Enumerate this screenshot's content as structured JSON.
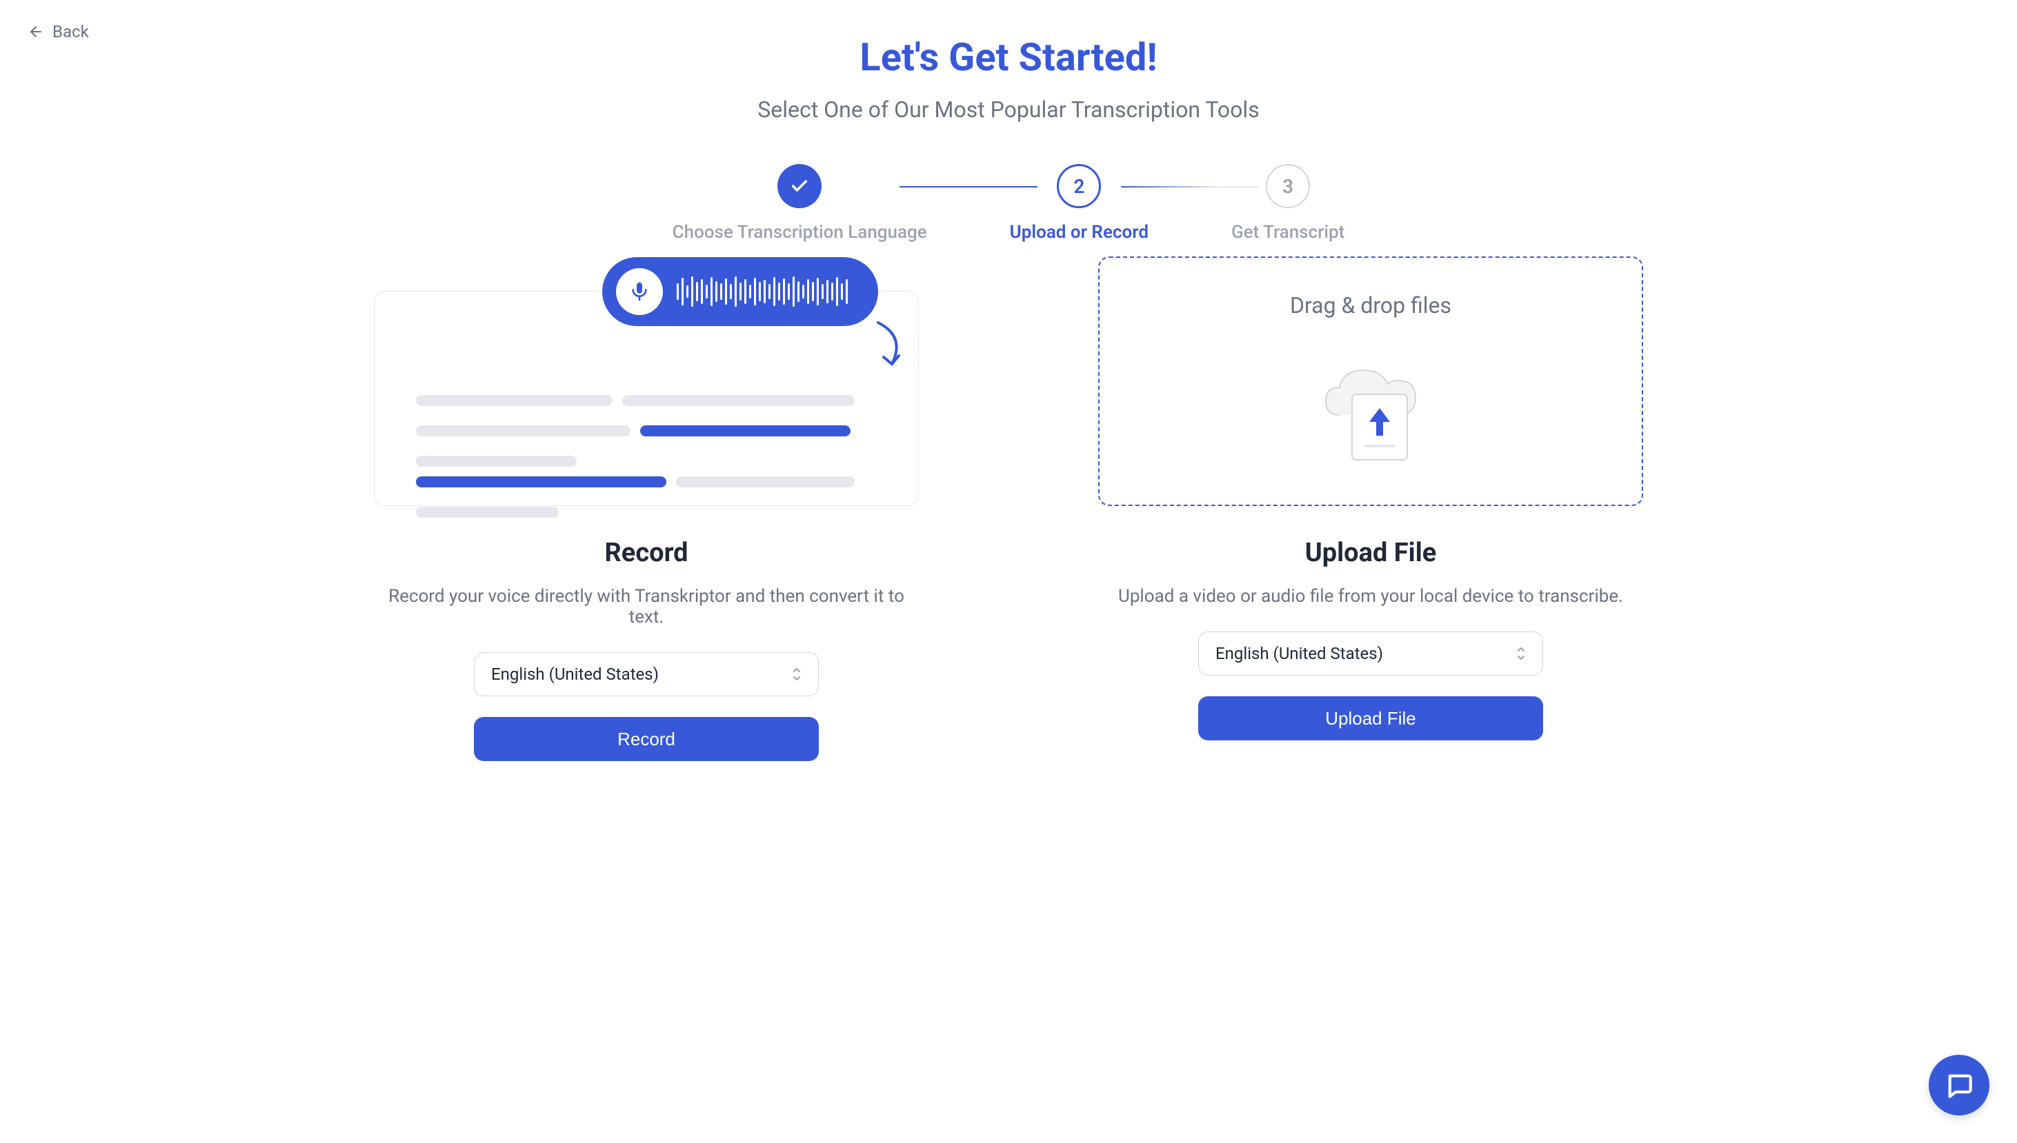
{
  "back": {
    "label": "Back"
  },
  "header": {
    "title": "Let's Get Started!",
    "subtitle": "Select One of Our Most Popular Transcription Tools"
  },
  "stepper": {
    "steps": [
      {
        "label": "Choose Transcription Language"
      },
      {
        "number": "2",
        "label": "Upload or Record"
      },
      {
        "number": "3",
        "label": "Get Transcript"
      }
    ]
  },
  "record": {
    "title": "Record",
    "description": "Record your voice directly with Transkriptor and then convert it to text.",
    "language": "English (United States)",
    "button": "Record"
  },
  "upload": {
    "drop_text": "Drag & drop files",
    "title": "Upload File",
    "description": "Upload a video or audio file from your local device to transcribe.",
    "language": "English (United States)",
    "button": "Upload File"
  }
}
